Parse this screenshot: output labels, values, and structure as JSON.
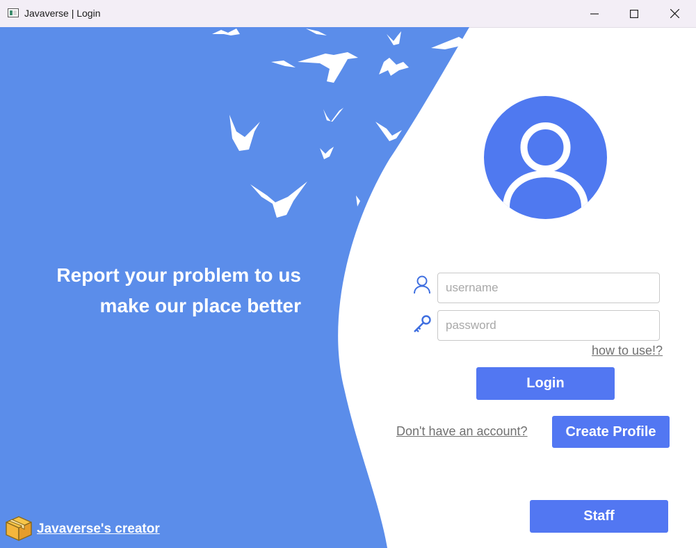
{
  "window": {
    "title": "Javaverse | Login",
    "controls": {
      "minimize": "—",
      "maximize": "☐",
      "close": "✕"
    }
  },
  "left": {
    "headline_line1": "Report your problem to us",
    "headline_line2": "make our place better",
    "creator_link": "Javaverse's creator",
    "creator_icon": "package-box-icon",
    "decoration": "flying-birds"
  },
  "login": {
    "avatar_icon": "user-avatar-icon",
    "username_icon": "user-icon",
    "password_icon": "key-icon",
    "username_placeholder": "username",
    "password_placeholder": "password",
    "help_link": "how to use!?",
    "login_button": "Login",
    "no_account_link": "Don't have an account?",
    "create_profile_button": "Create Profile",
    "staff_button": "Staff"
  },
  "colors": {
    "panel_blue": "#5b8dea",
    "button_blue": "#5277f2",
    "avatar_blue": "#4f79f0",
    "icon_blue": "#3f6fe0",
    "link_gray": "#707070"
  }
}
